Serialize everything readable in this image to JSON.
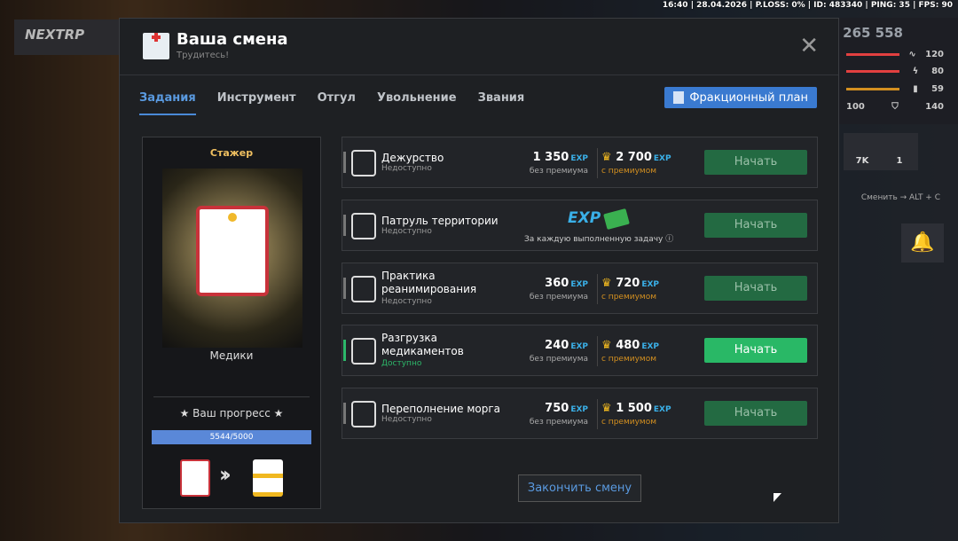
{
  "topbar": "16:40 | 28.04.2026 | P.LOSS: 0% | ID: 483340 | PING: 35 | FPS: 90",
  "logo": "NEXTRP",
  "hud": {
    "money": "265 558",
    "stats": [
      {
        "icon": "pulse-icon",
        "value": "120",
        "color": "#e24040"
      },
      {
        "icon": "lightning-icon",
        "value": "80",
        "color": "#e24040"
      },
      {
        "icon": "signal-icon",
        "value": "59",
        "color": "#d49020"
      },
      {
        "icon": "shield-icon",
        "value": "140",
        "left": "100"
      }
    ],
    "cash": [
      {
        "value": "7K"
      },
      {
        "value": "1"
      }
    ],
    "hint": "Сменить → ALT + C"
  },
  "modal": {
    "title": "Ваша смена",
    "subtitle": "Трудитесь!",
    "tabs": [
      {
        "label": "Задания",
        "active": true
      },
      {
        "label": "Инструмент"
      },
      {
        "label": "Отгул"
      },
      {
        "label": "Увольнение"
      },
      {
        "label": "Звания"
      }
    ],
    "plan_button": "Фракционный план",
    "card": {
      "rank": "Стажер",
      "faction": "Медики",
      "progress_label": "★ Ваш прогресс ★",
      "progress_text": "5544/5000",
      "progress_fraction": 1
    },
    "tasks": [
      {
        "name": "Дежурство",
        "status": "Недоступно",
        "exp": "1 350",
        "exp_premium": "2 700",
        "available": false
      },
      {
        "name": "Патруль территории",
        "status": "Недоступно",
        "per_task": "За каждую выполненную задачу",
        "available": false
      },
      {
        "name": "Практика реанимирования",
        "status": "Недоступно",
        "exp": "360",
        "exp_premium": "720",
        "available": false
      },
      {
        "name": "Разгрузка медикаментов",
        "status": "Доступно",
        "exp": "240",
        "exp_premium": "480",
        "available": true
      },
      {
        "name": "Переполнение морга",
        "status": "Недоступно",
        "exp": "750",
        "exp_premium": "1 500",
        "available": false
      }
    ],
    "exp_tag": "EXP",
    "no_premium": "без премиума",
    "with_premium": "с премиумом",
    "start": "Начать",
    "end_shift": "Закончить смену"
  }
}
